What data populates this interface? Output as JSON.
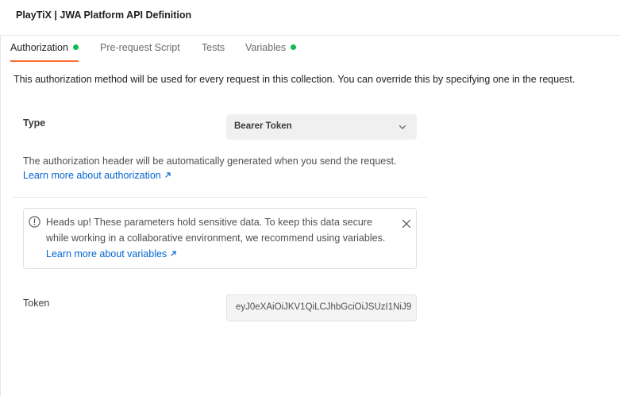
{
  "window": {
    "title": "PlayTiX | JWA Platform API Definition"
  },
  "tabs": [
    {
      "label": "Authorization",
      "active": true,
      "has_dot": true
    },
    {
      "label": "Pre-request Script",
      "active": false,
      "has_dot": false
    },
    {
      "label": "Tests",
      "active": false,
      "has_dot": false
    },
    {
      "label": "Variables",
      "active": false,
      "has_dot": true
    }
  ],
  "description": "This authorization method will be used for every request in this collection. You can override this by specifying one in the request.",
  "auth": {
    "type_label": "Type",
    "type_value": "Bearer Token",
    "help_text": "The authorization header will be automatically generated when you send the request.",
    "help_link": "Learn more about authorization"
  },
  "warning": {
    "text": "Heads up! These parameters hold sensitive data. To keep this data secure while working in a collaborative environment, we recommend using variables.",
    "link": "Learn more about variables"
  },
  "token": {
    "label": "Token",
    "value": "eyJ0eXAiOiJKV1QiLCJhbGciOiJSUzI1NiJ9"
  },
  "colors": {
    "accent": "#ff6c37",
    "status_dot": "#0cbb52",
    "link": "#0265d2"
  },
  "icons": {
    "dropdown": "chevron-down-icon",
    "external_link": "arrow-up-right-icon",
    "info": "info-icon",
    "close": "close-icon"
  }
}
